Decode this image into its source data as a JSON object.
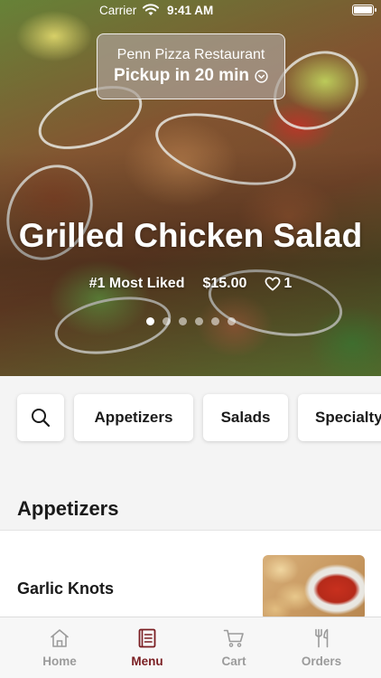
{
  "status_bar": {
    "carrier": "Carrier",
    "time": "9:41 AM"
  },
  "location": {
    "restaurant": "Penn Pizza Restaurant",
    "pickup": "Pickup in 20 min"
  },
  "featured": {
    "title": "Grilled Chicken Salad",
    "rank": "#1 Most Liked",
    "price": "$15.00",
    "likes": "1",
    "carousel_pages": 6,
    "carousel_active_index": 0
  },
  "categories": [
    "Appetizers",
    "Salads",
    "Specialty"
  ],
  "menu": {
    "section_title": "Appetizers",
    "items": [
      {
        "name": "Garlic Knots"
      }
    ]
  },
  "tab_bar": {
    "home": "Home",
    "menu": "Menu",
    "cart": "Cart",
    "orders": "Orders",
    "active": "menu"
  },
  "colors": {
    "accent": "#7a1e22",
    "inactive_tab": "#9b9b9b",
    "background": "#f4f4f4"
  }
}
